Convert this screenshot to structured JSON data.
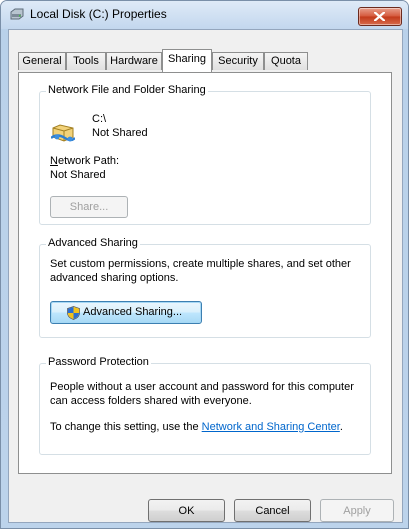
{
  "window": {
    "title": "Local Disk (C:) Properties",
    "accent": "#c23a1b"
  },
  "tabs": [
    {
      "label": "General",
      "active": false
    },
    {
      "label": "Tools",
      "active": false
    },
    {
      "label": "Hardware",
      "active": false
    },
    {
      "label": "Sharing",
      "active": true
    },
    {
      "label": "Security",
      "active": false
    },
    {
      "label": "Quota",
      "active": false
    }
  ],
  "network_sharing": {
    "title": "Network File and Folder Sharing",
    "drive": "C:\\",
    "state": "Not Shared",
    "path_label": "Network Path:",
    "path_value": "Not Shared",
    "share_button": "Share..."
  },
  "advanced_sharing": {
    "title": "Advanced Sharing",
    "description_line1": "Set custom permissions, create multiple shares, and set other",
    "description_line2": "advanced sharing options.",
    "button": "Advanced Sharing..."
  },
  "password_protection": {
    "title": "Password Protection",
    "line1": "People without a user account and password for this computer",
    "line2": "can access folders shared with everyone.",
    "change_prefix": "To change this setting, use the ",
    "link": "Network and Sharing Center",
    "change_suffix": "."
  },
  "footer": {
    "ok": "OK",
    "cancel": "Cancel",
    "apply": "Apply"
  },
  "icons": {
    "title": "drive-icon",
    "network_share": "network-folder-icon",
    "shield": "uac-shield-icon"
  }
}
